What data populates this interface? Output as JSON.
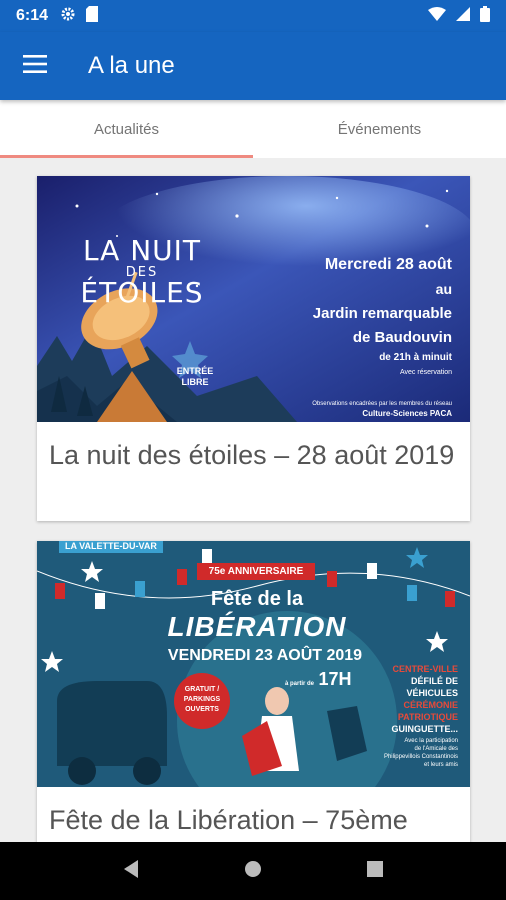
{
  "status_bar": {
    "time": "6:14"
  },
  "app_bar": {
    "title": "A la une"
  },
  "tabs": [
    {
      "label": "Actualités",
      "active": true
    },
    {
      "label": "Événements",
      "active": false
    }
  ],
  "cards": [
    {
      "title": "La nuit des étoiles – 28 août 2019",
      "image": {
        "headline_1": "LA NUIT",
        "headline_2": "DES",
        "headline_3": "ÉTOILES",
        "date": "Mercredi 28 août",
        "place_1": "au",
        "place_2": "Jardin remarquable",
        "place_3": "de Baudouvin",
        "hours": "de 21h à minuit",
        "reservation": "Avec réservation",
        "entry": "ENTRÉE LIBRE",
        "footer_1": "Observations encadrées par les membres du réseau",
        "footer_2": "Culture-Sciences PACA"
      }
    },
    {
      "title": "Fête de la Libération – 75ème",
      "image": {
        "tag": "LA VALETTE-DU-VAR",
        "anniversary": "75e ANNIVERSAIRE",
        "title_1": "Fête de la",
        "title_2": "LIBÉRATION",
        "date": "VENDREDI 23 AOÛT 2019",
        "from": "à partir de",
        "hour": "17H",
        "free_1": "GRATUIT /",
        "free_2": "PARKINGS",
        "free_3": "OUVERTS",
        "program_1": "CENTRE-VILLE",
        "program_2": "DÉFILÉ DE",
        "program_3": "VÉHICULES",
        "program_4": "CÉRÉMONIE",
        "program_5": "PATRIOTIQUE",
        "program_6": "GUINGUETTE...",
        "credits_1": "Avec la participation",
        "credits_2": "de l'Amicale des",
        "credits_3": "Philippevillois Constantinois",
        "credits_4": "et leurs amis"
      }
    }
  ],
  "colors": {
    "primary": "#1565c0",
    "tab_indicator": "#ef8a80",
    "poster1_sky": "#2a3a8c",
    "poster2_bg": "#1f5a7a",
    "poster2_red": "#d02a2a"
  }
}
